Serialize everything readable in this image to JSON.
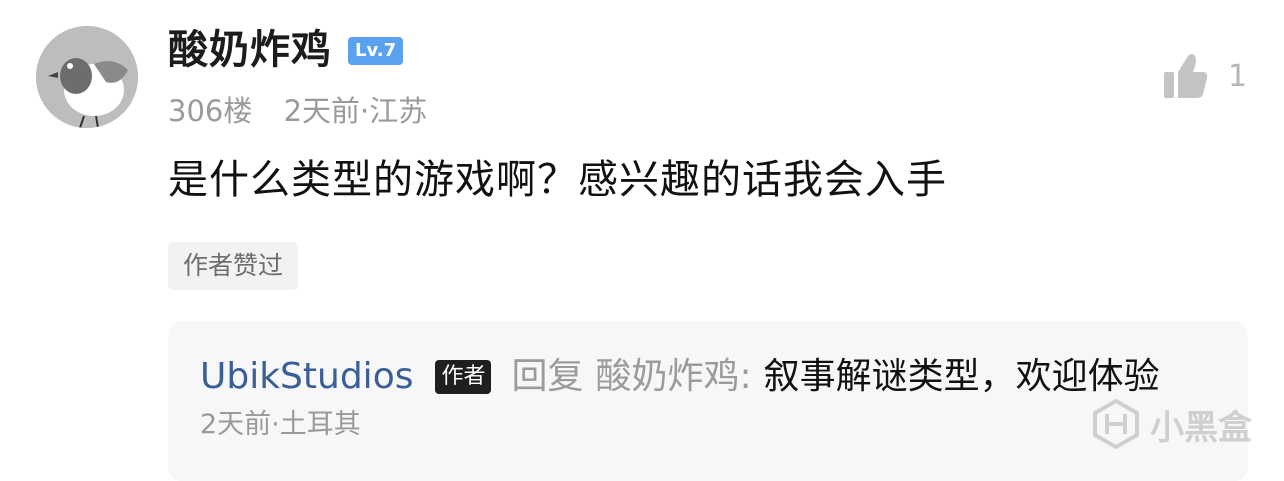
{
  "post": {
    "username": "酸奶炸鸡",
    "level": "Lv.7",
    "floor": "306楼",
    "time_location": "2天前·江苏",
    "like_count": "1",
    "content": "是什么类型的游戏啊？感兴趣的话我会入手",
    "author_liked_label": "作者赞过"
  },
  "reply": {
    "username": "UbikStudios",
    "author_tag": "作者",
    "reply_word": "回复",
    "target": "酸奶炸鸡:",
    "text": "叙事解谜类型，欢迎体验",
    "time_location": "2天前·土耳其"
  },
  "watermark": {
    "text": "小黑盒"
  },
  "icons": {
    "like": "thumbs-up-icon",
    "watermark_logo": "heybox-logo-icon"
  },
  "colors": {
    "level_badge": "#5aa2f0",
    "reply_username": "#3a5f96",
    "author_tag_bg": "#1f1f1f",
    "meta_text": "#9a9a9a"
  }
}
